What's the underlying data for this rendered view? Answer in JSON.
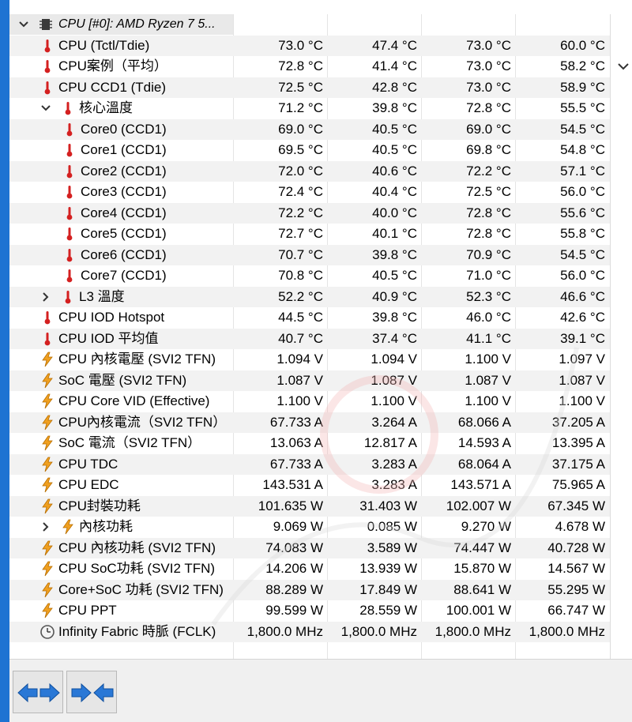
{
  "header": {
    "device_label": "CPU [#0]: AMD Ryzen 7 5..."
  },
  "rows": [
    {
      "name": "CPU (Tctl/Tdie)",
      "icon": "thermometer-icon",
      "indent": 0,
      "v": [
        "73.0 °C",
        "47.4 °C",
        "73.0 °C",
        "60.0 °C"
      ]
    },
    {
      "name": "CPU案例（平均）",
      "icon": "thermometer-icon",
      "indent": 0,
      "v": [
        "72.8 °C",
        "41.4 °C",
        "73.0 °C",
        "58.2 °C"
      ]
    },
    {
      "name": "CPU CCD1 (Tdie)",
      "icon": "thermometer-icon",
      "indent": 0,
      "v": [
        "72.5 °C",
        "42.8 °C",
        "73.0 °C",
        "58.9 °C"
      ]
    },
    {
      "name": "核心溫度",
      "icon": "thermometer-icon",
      "indent": 1,
      "expander": "collapse",
      "v": [
        "71.2 °C",
        "39.8 °C",
        "72.8 °C",
        "55.5 °C"
      ]
    },
    {
      "name": "Core0 (CCD1)",
      "icon": "thermometer-icon",
      "indent": 2,
      "v": [
        "69.0 °C",
        "40.5 °C",
        "69.0 °C",
        "54.5 °C"
      ]
    },
    {
      "name": "Core1 (CCD1)",
      "icon": "thermometer-icon",
      "indent": 2,
      "v": [
        "69.5 °C",
        "40.5 °C",
        "69.8 °C",
        "54.8 °C"
      ]
    },
    {
      "name": "Core2 (CCD1)",
      "icon": "thermometer-icon",
      "indent": 2,
      "v": [
        "72.0 °C",
        "40.6 °C",
        "72.2 °C",
        "57.1 °C"
      ]
    },
    {
      "name": "Core3 (CCD1)",
      "icon": "thermometer-icon",
      "indent": 2,
      "v": [
        "72.4 °C",
        "40.4 °C",
        "72.5 °C",
        "56.0 °C"
      ]
    },
    {
      "name": "Core4 (CCD1)",
      "icon": "thermometer-icon",
      "indent": 2,
      "v": [
        "72.2 °C",
        "40.0 °C",
        "72.8 °C",
        "55.6 °C"
      ]
    },
    {
      "name": "Core5 (CCD1)",
      "icon": "thermometer-icon",
      "indent": 2,
      "v": [
        "72.7 °C",
        "40.1 °C",
        "72.8 °C",
        "55.8 °C"
      ]
    },
    {
      "name": "Core6 (CCD1)",
      "icon": "thermometer-icon",
      "indent": 2,
      "v": [
        "70.7 °C",
        "39.8 °C",
        "70.9 °C",
        "54.5 °C"
      ]
    },
    {
      "name": "Core7 (CCD1)",
      "icon": "thermometer-icon",
      "indent": 2,
      "v": [
        "70.8 °C",
        "40.5 °C",
        "71.0 °C",
        "56.0 °C"
      ]
    },
    {
      "name": "L3 溫度",
      "icon": "thermometer-icon",
      "indent": 1,
      "expander": "expand",
      "v": [
        "52.2 °C",
        "40.9 °C",
        "52.3 °C",
        "46.6 °C"
      ]
    },
    {
      "name": "CPU IOD Hotspot",
      "icon": "thermometer-icon",
      "indent": 0,
      "v": [
        "44.5 °C",
        "39.8 °C",
        "46.0 °C",
        "42.6 °C"
      ]
    },
    {
      "name": "CPU IOD 平均值",
      "icon": "thermometer-icon",
      "indent": 0,
      "v": [
        "40.7 °C",
        "37.4 °C",
        "41.1 °C",
        "39.1 °C"
      ]
    },
    {
      "name": "CPU 內核電壓 (SVI2 TFN)",
      "icon": "lightning-icon",
      "indent": 0,
      "v": [
        "1.094 V",
        "1.094 V",
        "1.100 V",
        "1.097 V"
      ]
    },
    {
      "name": "SoC 電壓 (SVI2 TFN)",
      "icon": "lightning-icon",
      "indent": 0,
      "v": [
        "1.087 V",
        "1.087 V",
        "1.087 V",
        "1.087 V"
      ]
    },
    {
      "name": "CPU Core VID (Effective)",
      "icon": "lightning-icon",
      "indent": 0,
      "v": [
        "1.100 V",
        "1.100 V",
        "1.100 V",
        "1.100 V"
      ]
    },
    {
      "name": "CPU內核電流（SVI2 TFN）",
      "icon": "lightning-icon",
      "indent": 0,
      "v": [
        "67.733 A",
        "3.264 A",
        "68.066 A",
        "37.205 A"
      ]
    },
    {
      "name": "SoC 電流（SVI2 TFN）",
      "icon": "lightning-icon",
      "indent": 0,
      "v": [
        "13.063 A",
        "12.817 A",
        "14.593 A",
        "13.395 A"
      ]
    },
    {
      "name": "CPU TDC",
      "icon": "lightning-icon",
      "indent": 0,
      "v": [
        "67.733 A",
        "3.283 A",
        "68.064 A",
        "37.175 A"
      ]
    },
    {
      "name": "CPU EDC",
      "icon": "lightning-icon",
      "indent": 0,
      "v": [
        "143.531 A",
        "3.283 A",
        "143.571 A",
        "75.965 A"
      ]
    },
    {
      "name": "CPU封裝功耗",
      "icon": "lightning-icon",
      "indent": 0,
      "v": [
        "101.635 W",
        "31.403 W",
        "102.007 W",
        "67.345 W"
      ]
    },
    {
      "name": "內核功耗",
      "icon": "lightning-icon",
      "indent": 1,
      "expander": "expand",
      "v": [
        "9.069 W",
        "0.085 W",
        "9.270 W",
        "4.678 W"
      ]
    },
    {
      "name": "CPU 內核功耗 (SVI2 TFN)",
      "icon": "lightning-icon",
      "indent": 0,
      "v": [
        "74.083 W",
        "3.589 W",
        "74.447 W",
        "40.728 W"
      ]
    },
    {
      "name": "CPU SoC功耗 (SVI2 TFN)",
      "icon": "lightning-icon",
      "indent": 0,
      "v": [
        "14.206 W",
        "13.939 W",
        "15.870 W",
        "14.567 W"
      ]
    },
    {
      "name": "Core+SoC 功耗 (SVI2 TFN)",
      "icon": "lightning-icon",
      "indent": 0,
      "v": [
        "88.289 W",
        "17.849 W",
        "88.641 W",
        "55.295 W"
      ]
    },
    {
      "name": "CPU PPT",
      "icon": "lightning-icon",
      "indent": 0,
      "v": [
        "99.599 W",
        "28.559 W",
        "100.001 W",
        "66.747 W"
      ]
    },
    {
      "name": "Infinity Fabric 時脈 (FCLK)",
      "icon": "clock-icon",
      "indent": 0,
      "v": [
        "1,800.0 MHz",
        "1,800.0 MHz",
        "1,800.0 MHz",
        "1,800.0 MHz"
      ]
    }
  ],
  "toolbar": {
    "back_button": "arrows-left-right-icon",
    "collapse_button": "arrows-inward-icon"
  },
  "colors": {
    "accent_blue": "#1e73d2",
    "thermometer_red": "#d42020",
    "lightning_orange": "#f0a020",
    "alt_row": "#f2f2f2"
  }
}
